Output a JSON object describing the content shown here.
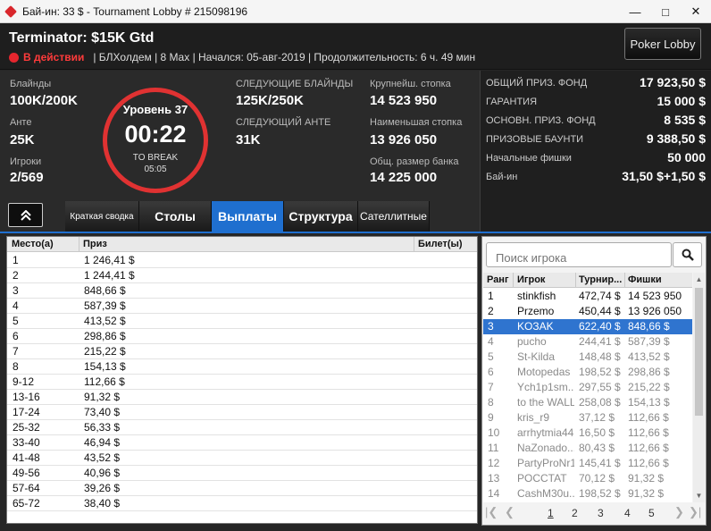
{
  "titlebar": {
    "title": "Бай-ин: 33 $ - Tournament Lobby # 215098196",
    "minimize": "—",
    "maximize": "□",
    "close": "✕"
  },
  "header": {
    "name": "Terminator: $15K Gtd",
    "status": "В действии",
    "details": "| БЛХолдем | 8 Max | Начался: 05-авг-2019 | Продолжительность: 6 ч. 49 мин",
    "lobby_button": "Poker Lobby"
  },
  "info": {
    "blinds_label": "Блайнды",
    "blinds": "100K/200K",
    "ante_label": "Анте",
    "ante": "25K",
    "players_label": "Игроки",
    "players": "2/569",
    "level": "Уровень 37",
    "clock": "00:22",
    "to_break": "TO BREAK",
    "break_time": "05:05",
    "next_blinds_label": "СЛЕДУЮЩИЕ БЛАЙНДЫ",
    "next_blinds": "125K/250K",
    "next_ante_label": "СЛЕДУЮЩИЙ АНТЕ",
    "next_ante": "31K",
    "largest_label": "Крупнейш. стопка",
    "largest": "14 523 950",
    "smallest_label": "Наименьшая стопка",
    "smallest": "13 926 050",
    "bank_label": "Общ. размер банка",
    "bank": "14 225 000"
  },
  "prize": [
    {
      "label": "ОБЩИЙ ПРИЗ. ФОНД",
      "value": "17 923,50 $"
    },
    {
      "label": "ГАРАНТИЯ",
      "value": "15 000 $"
    },
    {
      "label": "ОСНОВН. ПРИЗ. ФОНД",
      "value": "8 535 $"
    },
    {
      "label": "ПРИЗОВЫЕ БАУНТИ",
      "value": "9 388,50 $"
    },
    {
      "label": "Начальные фишки",
      "value": "50 000"
    },
    {
      "label": "Бай-ин",
      "value": "31,50 $+1,50 $"
    }
  ],
  "tabs": [
    {
      "label": "Краткая сводка"
    },
    {
      "label": "Столы"
    },
    {
      "label": "Выплаты"
    },
    {
      "label": "Структура"
    },
    {
      "label": "Сателлитные"
    }
  ],
  "payouts": {
    "headers": [
      "Место(а)",
      "Приз",
      "Билет(ы)"
    ],
    "rows": [
      [
        "1",
        "1 246,41 $"
      ],
      [
        "2",
        "1 244,41 $"
      ],
      [
        "3",
        "848,66 $"
      ],
      [
        "4",
        "587,39 $"
      ],
      [
        "5",
        "413,52 $"
      ],
      [
        "6",
        "298,86 $"
      ],
      [
        "7",
        "215,22 $"
      ],
      [
        "8",
        "154,13 $"
      ],
      [
        "9-12",
        "112,66 $"
      ],
      [
        "13-16",
        "91,32 $"
      ],
      [
        "17-24",
        "73,40 $"
      ],
      [
        "25-32",
        "56,33 $"
      ],
      [
        "33-40",
        "46,94 $"
      ],
      [
        "41-48",
        "43,52 $"
      ],
      [
        "49-56",
        "40,96 $"
      ],
      [
        "57-64",
        "39,26 $"
      ],
      [
        "65-72",
        "38,40 $"
      ]
    ]
  },
  "players": {
    "search_placeholder": "Поиск игрока",
    "headers": [
      "Ранг",
      "Игрок",
      "Турнир...",
      "Фишки"
    ],
    "rows": [
      [
        "1",
        "stinkfish",
        "472,74 $",
        "14 523 950"
      ],
      [
        "2",
        "Przemo",
        "450,44 $",
        "13 926 050"
      ],
      [
        "3",
        "KOЗAK",
        "622,40 $",
        "848,66 $"
      ],
      [
        "4",
        "pucho",
        "244,41 $",
        "587,39 $"
      ],
      [
        "5",
        "St-Kilda",
        "148,48 $",
        "413,52 $"
      ],
      [
        "6",
        "Motopedas",
        "198,52 $",
        "298,86 $"
      ],
      [
        "7",
        "Ych1p1sm...",
        "297,55 $",
        "215,22 $"
      ],
      [
        "8",
        "to the WALL",
        "258,08 $",
        "154,13 $"
      ],
      [
        "9",
        "kris_r9",
        "37,12 $",
        "112,66 $"
      ],
      [
        "10",
        "arrhytmia44",
        "16,50 $",
        "112,66 $"
      ],
      [
        "11",
        "NaZonado...",
        "80,43 $",
        "112,66 $"
      ],
      [
        "12",
        "PartyProNr1",
        "145,41 $",
        "112,66 $"
      ],
      [
        "13",
        "POCCTAT",
        "70,12 $",
        "91,32 $"
      ],
      [
        "14",
        "CashM30u...",
        "198,52 $",
        "91,32 $"
      ]
    ],
    "pages": [
      "1",
      "2",
      "3",
      "4",
      "5"
    ]
  },
  "colors": {
    "accent": "#1f6fcf",
    "live": "#ff3b3b",
    "clock_ring": "#e03232"
  }
}
